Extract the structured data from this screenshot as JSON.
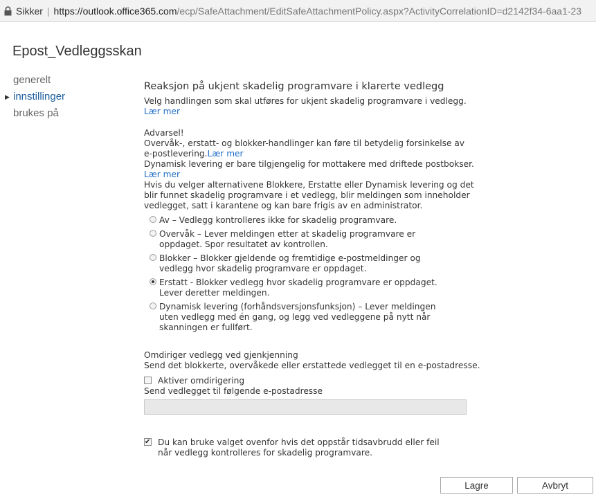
{
  "addressbar": {
    "secure_label": "Sikker",
    "url_host": "https://outlook.office365.com",
    "url_path": "/ecp/SafeAttachment/EditSafeAttachmentPolicy.aspx?ActivityCorrelationID=d2142f34-6aa1-23"
  },
  "page": {
    "title": "Epost_Vedleggsskan"
  },
  "nav": {
    "items": [
      {
        "label": "generelt"
      },
      {
        "label": "innstillinger"
      },
      {
        "label": "brukes på"
      }
    ]
  },
  "section": {
    "title": "Reaksjon på ukjent skadelig programvare i klarerte vedlegg",
    "desc": "Velg handlingen som skal utføres for ukjent skadelig programvare i vedlegg.",
    "learn_more": "Lær mer",
    "warning_title": "Advarsel!",
    "warning_line1": "Overvåk-, erstatt- og blokker-handlinger kan føre til betydelig forsinkelse av e-postlevering.",
    "warning_line1_link": "Lær mer",
    "warning_line2": "Dynamisk levering er bare tilgjengelig for mottakere med driftede postbokser.",
    "warning_line2_link": "Lær mer",
    "warning_line3": "Hvis du velger alternativene Blokkere, Erstatte eller Dynamisk levering og det blir funnet skadelig programvare i et vedlegg, blir meldingen som inneholder vedlegget, satt i karantene og kan bare frigis av en administrator."
  },
  "options": [
    {
      "label": "Av – Vedlegg kontrolleres ikke for skadelig programvare.",
      "selected": false
    },
    {
      "label": "Overvåk – Lever meldingen etter at skadelig programvare er oppdaget. Spor resultatet av kontrollen.",
      "selected": false
    },
    {
      "label": "Blokker – Blokker gjeldende og fremtidige e-postmeldinger og vedlegg hvor skadelig programvare er oppdaget.",
      "selected": false
    },
    {
      "label": "Erstatt - Blokker vedlegg hvor skadelig programvare er oppdaget. Lever deretter meldingen.",
      "selected": true
    },
    {
      "label": "Dynamisk levering (forhåndsversjonsfunksjon) – Lever meldingen uten vedlegg med én gang, og legg ved vedleggene på nytt når skanningen er fullført.",
      "selected": false
    }
  ],
  "redirect": {
    "title": "Omdiriger vedlegg ved gjenkjenning",
    "desc": "Send det blokkerte, overvåkede eller erstattede vedlegget til en e-postadresse.",
    "enable_label": "Aktiver omdirigering",
    "enable_checked": false,
    "address_label": "Send vedlegget til følgende e-postadresse",
    "address_value": ""
  },
  "timeout": {
    "label": "Du kan bruke valget ovenfor hvis det oppstår tidsavbrudd eller feil når vedlegg kontrolleres for skadelig programvare.",
    "checked": true
  },
  "buttons": {
    "save": "Lagre",
    "cancel": "Avbryt"
  }
}
